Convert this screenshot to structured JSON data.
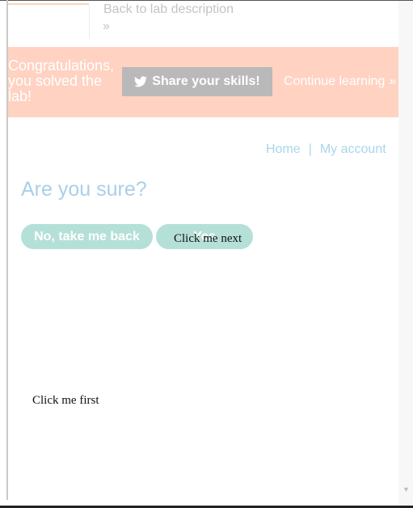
{
  "header": {
    "back_link": "Back to lab description",
    "back_chevron": "»"
  },
  "banner": {
    "message": "Congratulations, you solved the lab!",
    "share_button": "Share your skills!",
    "continue_link": "Continue learning",
    "continue_chevron": "»"
  },
  "nav": {
    "home": "Home",
    "separator": "|",
    "account": "My account"
  },
  "main": {
    "heading": "Are you sure?",
    "no_button": "No, take me back",
    "yes_button": "Yes"
  },
  "overlay": {
    "click_next": "Click me next",
    "click_first": "Click me first"
  },
  "colors": {
    "banner_bg": "#ffd2c1",
    "button_bg": "#b4e0d8",
    "link": "#a8d6ea",
    "share_bg": "#b9b9b9"
  },
  "icons": {
    "share": "twitter-icon",
    "scroll": "scroll-down-icon"
  }
}
